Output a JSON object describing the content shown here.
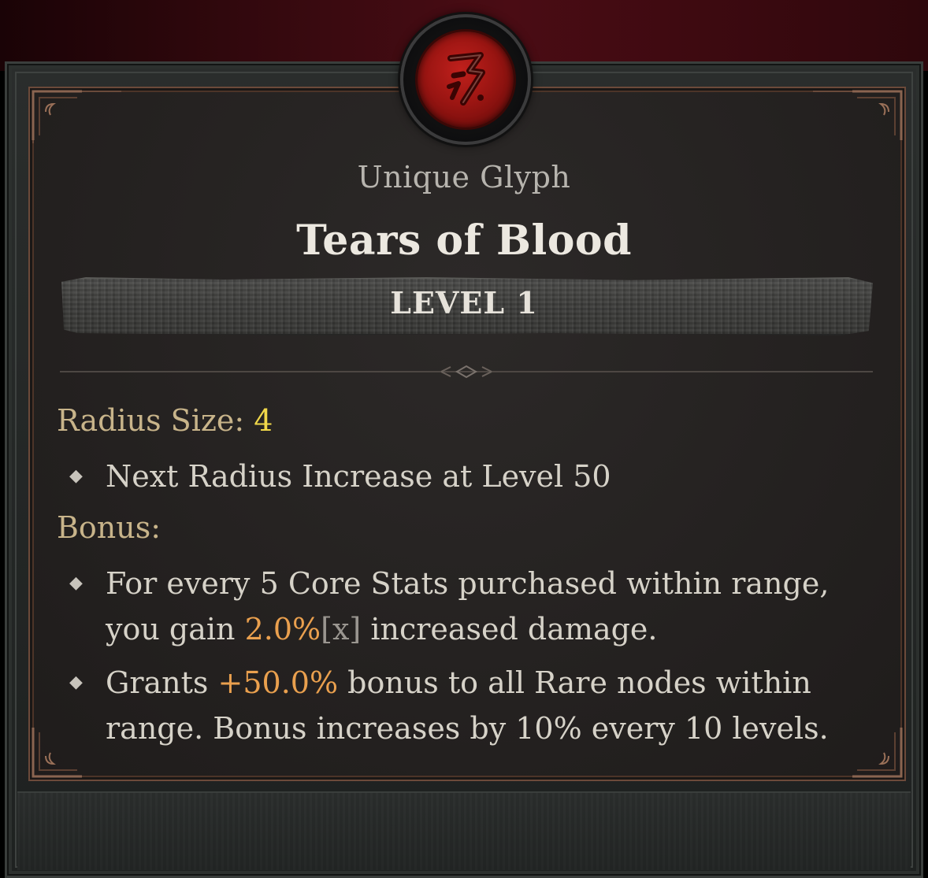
{
  "tooltip": {
    "item_type": "Unique Glyph",
    "item_name": "Tears of Blood",
    "level_label": "LEVEL 1",
    "emblem_icon": "red-glyph-rune-icon",
    "radius": {
      "label": "Radius Size:",
      "value": "4",
      "next_note": "Next Radius Increase at Level 50"
    },
    "bonus": {
      "label": "Bonus:",
      "line1_a": "For every 5 Core Stats purchased within range,",
      "line1_b_prefix": "you gain ",
      "line1_b_value": "2.0%",
      "line1_b_tag": "[x]",
      "line1_b_suffix": " increased damage.",
      "line2_a_prefix": "Grants ",
      "line2_a_value": "+50.0%",
      "line2_a_suffix": " bonus to all Rare nodes within",
      "line2_b": "range. Bonus increases by 10% every 10 levels."
    },
    "colors": {
      "label_gold": "#c8b48a",
      "value_yellow": "#f1d84a",
      "highlight_orange": "#eaa04e",
      "emblem_red": "#b01c18",
      "frame_copper": "#6c4a3a"
    }
  }
}
